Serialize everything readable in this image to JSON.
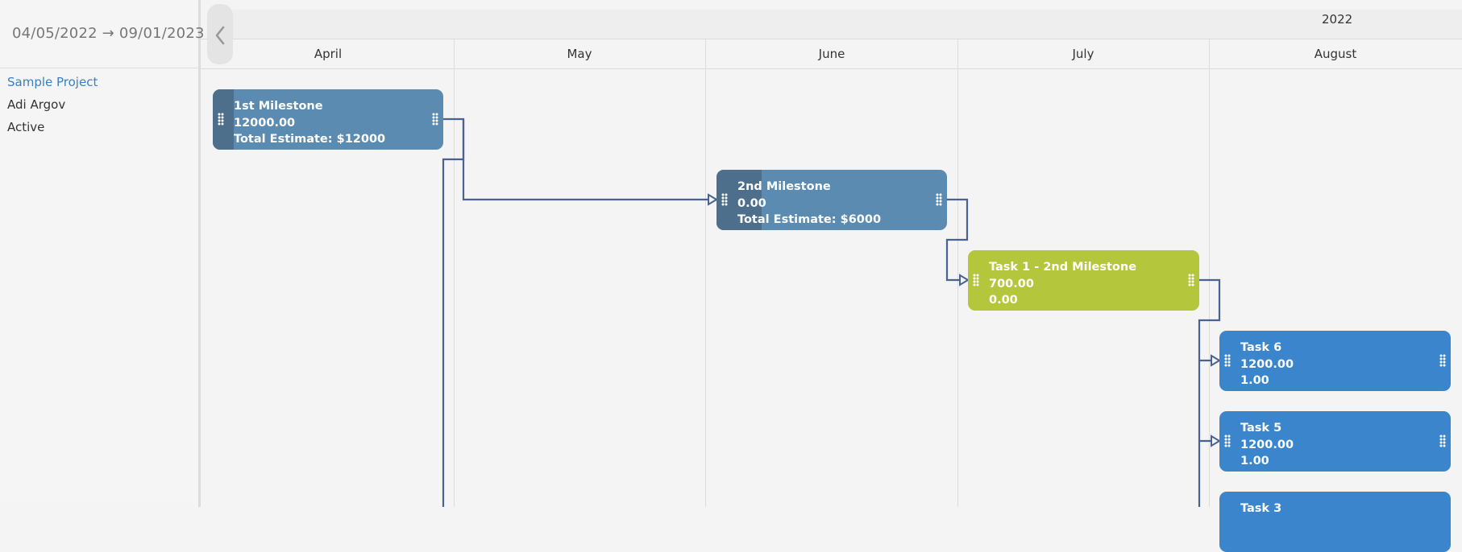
{
  "left_panel": {
    "date_range": "04/05/2022 → 09/01/2023",
    "project_name": "Sample Project",
    "owner": "Adi Argov",
    "status": "Active"
  },
  "timeline": {
    "year": "2022",
    "months": [
      "April",
      "May",
      "June",
      "July",
      "August"
    ]
  },
  "tasks": [
    {
      "name": "1st Milestone",
      "line2": "12000.00",
      "line3": "Total Estimate: $12000",
      "type": "milestone"
    },
    {
      "name": "2nd Milestone",
      "line2": "0.00",
      "line3": "Total Estimate: $6000",
      "type": "milestone"
    },
    {
      "name": "Task 1 - 2nd Milestone",
      "line2": "700.00",
      "line3": "0.00",
      "type": "task"
    },
    {
      "name": "Task 6",
      "line2": "1200.00",
      "line3": "1.00",
      "type": "task"
    },
    {
      "name": "Task 5",
      "line2": "1200.00",
      "line3": "1.00",
      "type": "task"
    },
    {
      "name": "Task 3",
      "line2": "",
      "line3": "",
      "type": "task"
    }
  ],
  "colors": {
    "milestone": "#5b8bb0",
    "milestone_progress": "#4d6f8c",
    "task_green": "#b4c63c",
    "task_blue": "#3a85cb",
    "dependency_line": "#4a6290",
    "link": "#3a7fc1"
  },
  "icons": {
    "back": "chevron-left-icon",
    "handle": "drag-handle-icon"
  }
}
